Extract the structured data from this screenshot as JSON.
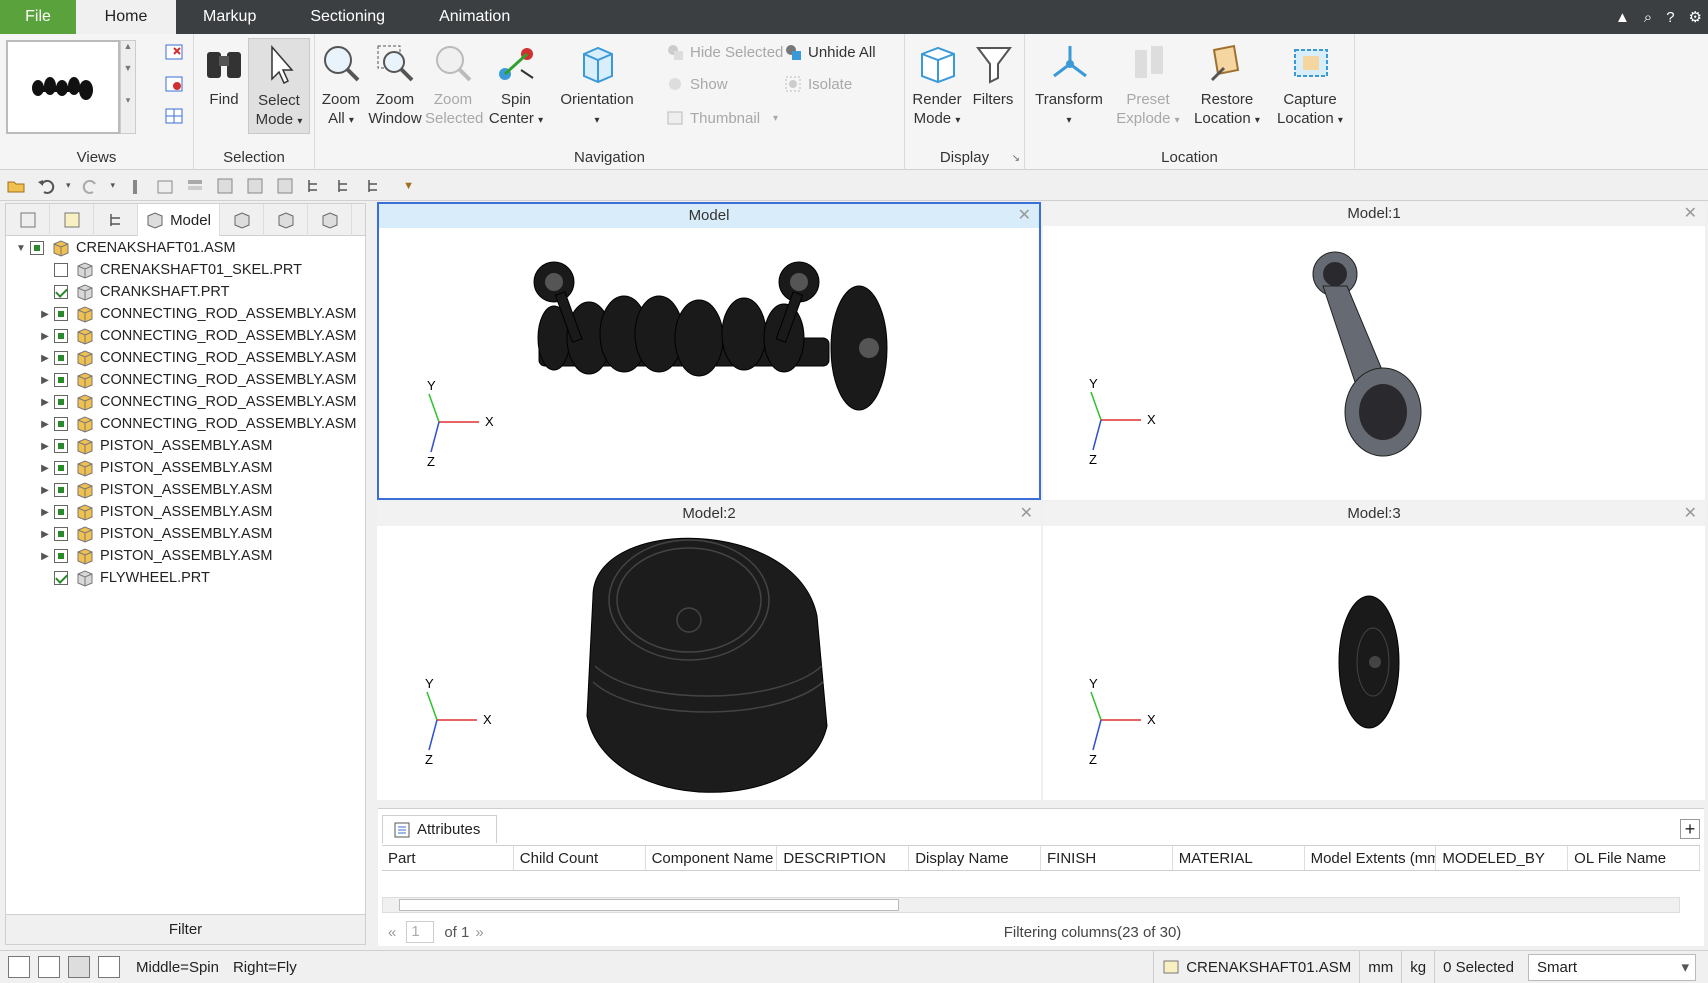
{
  "tabs": [
    {
      "label": "File"
    },
    {
      "label": "Home"
    },
    {
      "label": "Markup"
    },
    {
      "label": "Sectioning"
    },
    {
      "label": "Animation"
    }
  ],
  "ribbon": {
    "views": {
      "group_label": "Views"
    },
    "selection": {
      "group_label": "Selection",
      "find": "Find",
      "select_mode": "Select\nMode"
    },
    "navigation": {
      "group_label": "Navigation",
      "zoom_all": "Zoom\nAll",
      "zoom_window": "Zoom\nWindow",
      "zoom_selected": "Zoom\nSelected",
      "spin_center": "Spin\nCenter",
      "orientation": "Orientation"
    },
    "visibility": {
      "hide_selected": "Hide Selected",
      "unhide_all": "Unhide All",
      "show": "Show",
      "isolate": "Isolate",
      "thumbnail": "Thumbnail"
    },
    "display": {
      "group_label": "Display",
      "render_mode": "Render\nMode",
      "filters": "Filters"
    },
    "location": {
      "group_label": "Location",
      "transform": "Transform",
      "preset_explode": "Preset\nExplode",
      "restore_location": "Restore\nLocation",
      "capture_location": "Capture\nLocation"
    }
  },
  "left_panel": {
    "model_tab": "Model",
    "filter_label": "Filter",
    "tree": [
      {
        "label": "CRENAKSHAFT01.ASM",
        "level": 0,
        "expander": "▼",
        "check": "part"
      },
      {
        "label": "CRENAKSHAFT01_SKEL.PRT",
        "level": 1,
        "expander": "",
        "check": "off"
      },
      {
        "label": "CRANKSHAFT.PRT",
        "level": 1,
        "expander": "",
        "check": "on"
      },
      {
        "label": "CONNECTING_ROD_ASSEMBLY.ASM",
        "level": 1,
        "expander": "▶",
        "check": "part"
      },
      {
        "label": "CONNECTING_ROD_ASSEMBLY.ASM",
        "level": 1,
        "expander": "▶",
        "check": "part"
      },
      {
        "label": "CONNECTING_ROD_ASSEMBLY.ASM",
        "level": 1,
        "expander": "▶",
        "check": "part"
      },
      {
        "label": "CONNECTING_ROD_ASSEMBLY.ASM",
        "level": 1,
        "expander": "▶",
        "check": "part"
      },
      {
        "label": "CONNECTING_ROD_ASSEMBLY.ASM",
        "level": 1,
        "expander": "▶",
        "check": "part"
      },
      {
        "label": "CONNECTING_ROD_ASSEMBLY.ASM",
        "level": 1,
        "expander": "▶",
        "check": "part"
      },
      {
        "label": "PISTON_ASSEMBLY.ASM",
        "level": 1,
        "expander": "▶",
        "check": "part"
      },
      {
        "label": "PISTON_ASSEMBLY.ASM",
        "level": 1,
        "expander": "▶",
        "check": "part"
      },
      {
        "label": "PISTON_ASSEMBLY.ASM",
        "level": 1,
        "expander": "▶",
        "check": "part"
      },
      {
        "label": "PISTON_ASSEMBLY.ASM",
        "level": 1,
        "expander": "▶",
        "check": "part"
      },
      {
        "label": "PISTON_ASSEMBLY.ASM",
        "level": 1,
        "expander": "▶",
        "check": "part"
      },
      {
        "label": "PISTON_ASSEMBLY.ASM",
        "level": 1,
        "expander": "▶",
        "check": "part"
      },
      {
        "label": "FLYWHEEL.PRT",
        "level": 1,
        "expander": "",
        "check": "on"
      }
    ]
  },
  "viewports": [
    {
      "title": "Model",
      "active": true
    },
    {
      "title": "Model:1",
      "active": false
    },
    {
      "title": "Model:2",
      "active": false
    },
    {
      "title": "Model:3",
      "active": false
    }
  ],
  "axis": {
    "x": "X",
    "y": "Y",
    "z": "Z"
  },
  "attributes": {
    "tab_label": "Attributes",
    "columns": [
      "Part",
      "Child Count",
      "Component Name",
      "DESCRIPTION",
      "Display Name",
      "FINISH",
      "MATERIAL",
      "Model Extents (mm)",
      "MODELED_BY",
      "OL File Name"
    ],
    "page_value": "1",
    "page_of": "of 1",
    "filter_status": "Filtering columns(23 of 30)"
  },
  "status": {
    "middle": "Middle=Spin",
    "right": "Right=Fly",
    "file": "CRENAKSHAFT01.ASM",
    "length_unit": "mm",
    "mass_unit": "kg",
    "selected": "0 Selected",
    "filter_mode": "Smart"
  },
  "colors": {
    "file_tab": "#5aa33c",
    "active_viewport_border": "#3a6fd8",
    "axis_x": "#e03030",
    "axis_y": "#30c030",
    "axis_z": "#3050d0"
  }
}
